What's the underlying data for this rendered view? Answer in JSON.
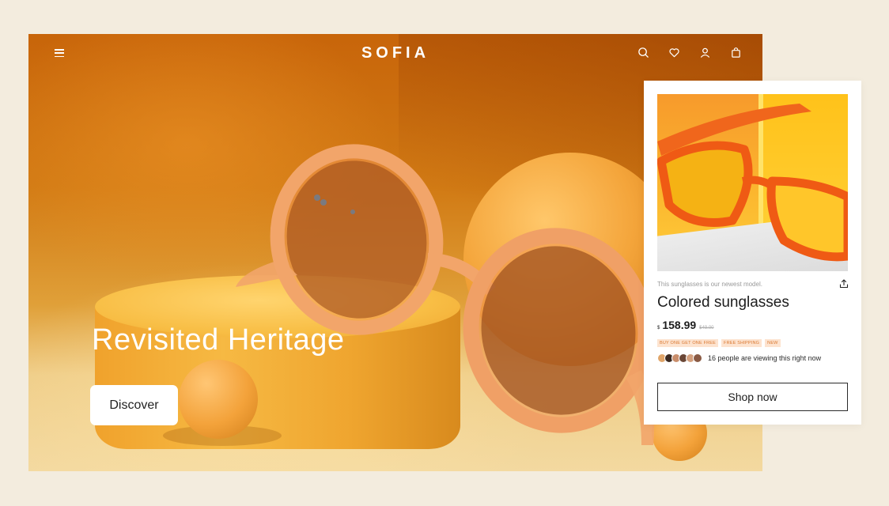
{
  "header": {
    "brand": "SOFIA",
    "icons": [
      "menu-icon",
      "search-icon",
      "heart-icon",
      "user-icon",
      "bag-icon"
    ]
  },
  "hero": {
    "title": "Revisited Heritage",
    "cta_label": "Discover"
  },
  "product": {
    "tagline": "This sunglasses is our newest model.",
    "title": "Colored sunglasses",
    "currency": "$",
    "price": "158.99",
    "old_price": "$49.00",
    "badges": [
      "BUY ONE GET ONE FREE",
      "FREE SHIPPING",
      "NEW"
    ],
    "viewers_text": "16 people are viewing this right now",
    "cta_label": "Shop now"
  },
  "colors": {
    "background": "#f3ecde",
    "badge_bg": "#fde3cf",
    "badge_text": "#d9772f"
  }
}
